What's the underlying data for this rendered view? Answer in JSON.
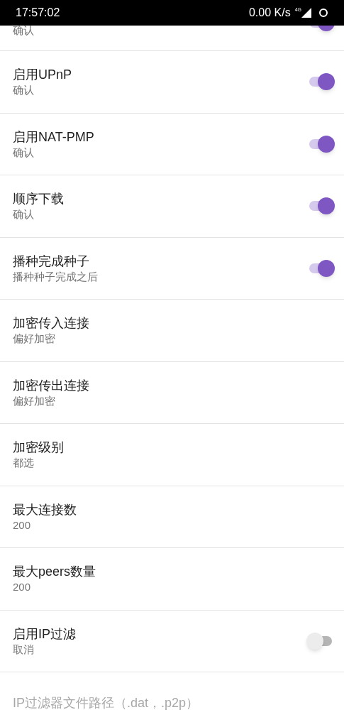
{
  "status_bar": {
    "time": "17:57:02",
    "speed": "0.00 K/s",
    "network": "4G"
  },
  "partial_item": {
    "subtitle": "确认",
    "on": true
  },
  "items": [
    {
      "kind": "switch",
      "title": "启用UPnP",
      "subtitle": "确认",
      "on": true,
      "disabled": false
    },
    {
      "kind": "switch",
      "title": "启用NAT-PMP",
      "subtitle": "确认",
      "on": true,
      "disabled": false
    },
    {
      "kind": "switch",
      "title": "顺序下载",
      "subtitle": "确认",
      "on": true,
      "disabled": false
    },
    {
      "kind": "switch",
      "title": "播种完成种子",
      "subtitle": "播种种子完成之后",
      "on": true,
      "disabled": false
    },
    {
      "kind": "plain",
      "title": "加密传入连接",
      "subtitle": "偏好加密",
      "disabled": false
    },
    {
      "kind": "plain",
      "title": "加密传出连接",
      "subtitle": "偏好加密",
      "disabled": false
    },
    {
      "kind": "plain",
      "title": "加密级别",
      "subtitle": "都选",
      "disabled": false
    },
    {
      "kind": "plain",
      "title": "最大连接数",
      "subtitle": "200",
      "disabled": false
    },
    {
      "kind": "plain",
      "title": "最大peers数量",
      "subtitle": "200",
      "disabled": false
    },
    {
      "kind": "switch",
      "title": "启用IP过滤",
      "subtitle": "取消",
      "on": false,
      "disabled": false
    },
    {
      "kind": "plain",
      "title": "IP过滤器文件路径（.dat，.p2p）",
      "disabled": true
    }
  ]
}
